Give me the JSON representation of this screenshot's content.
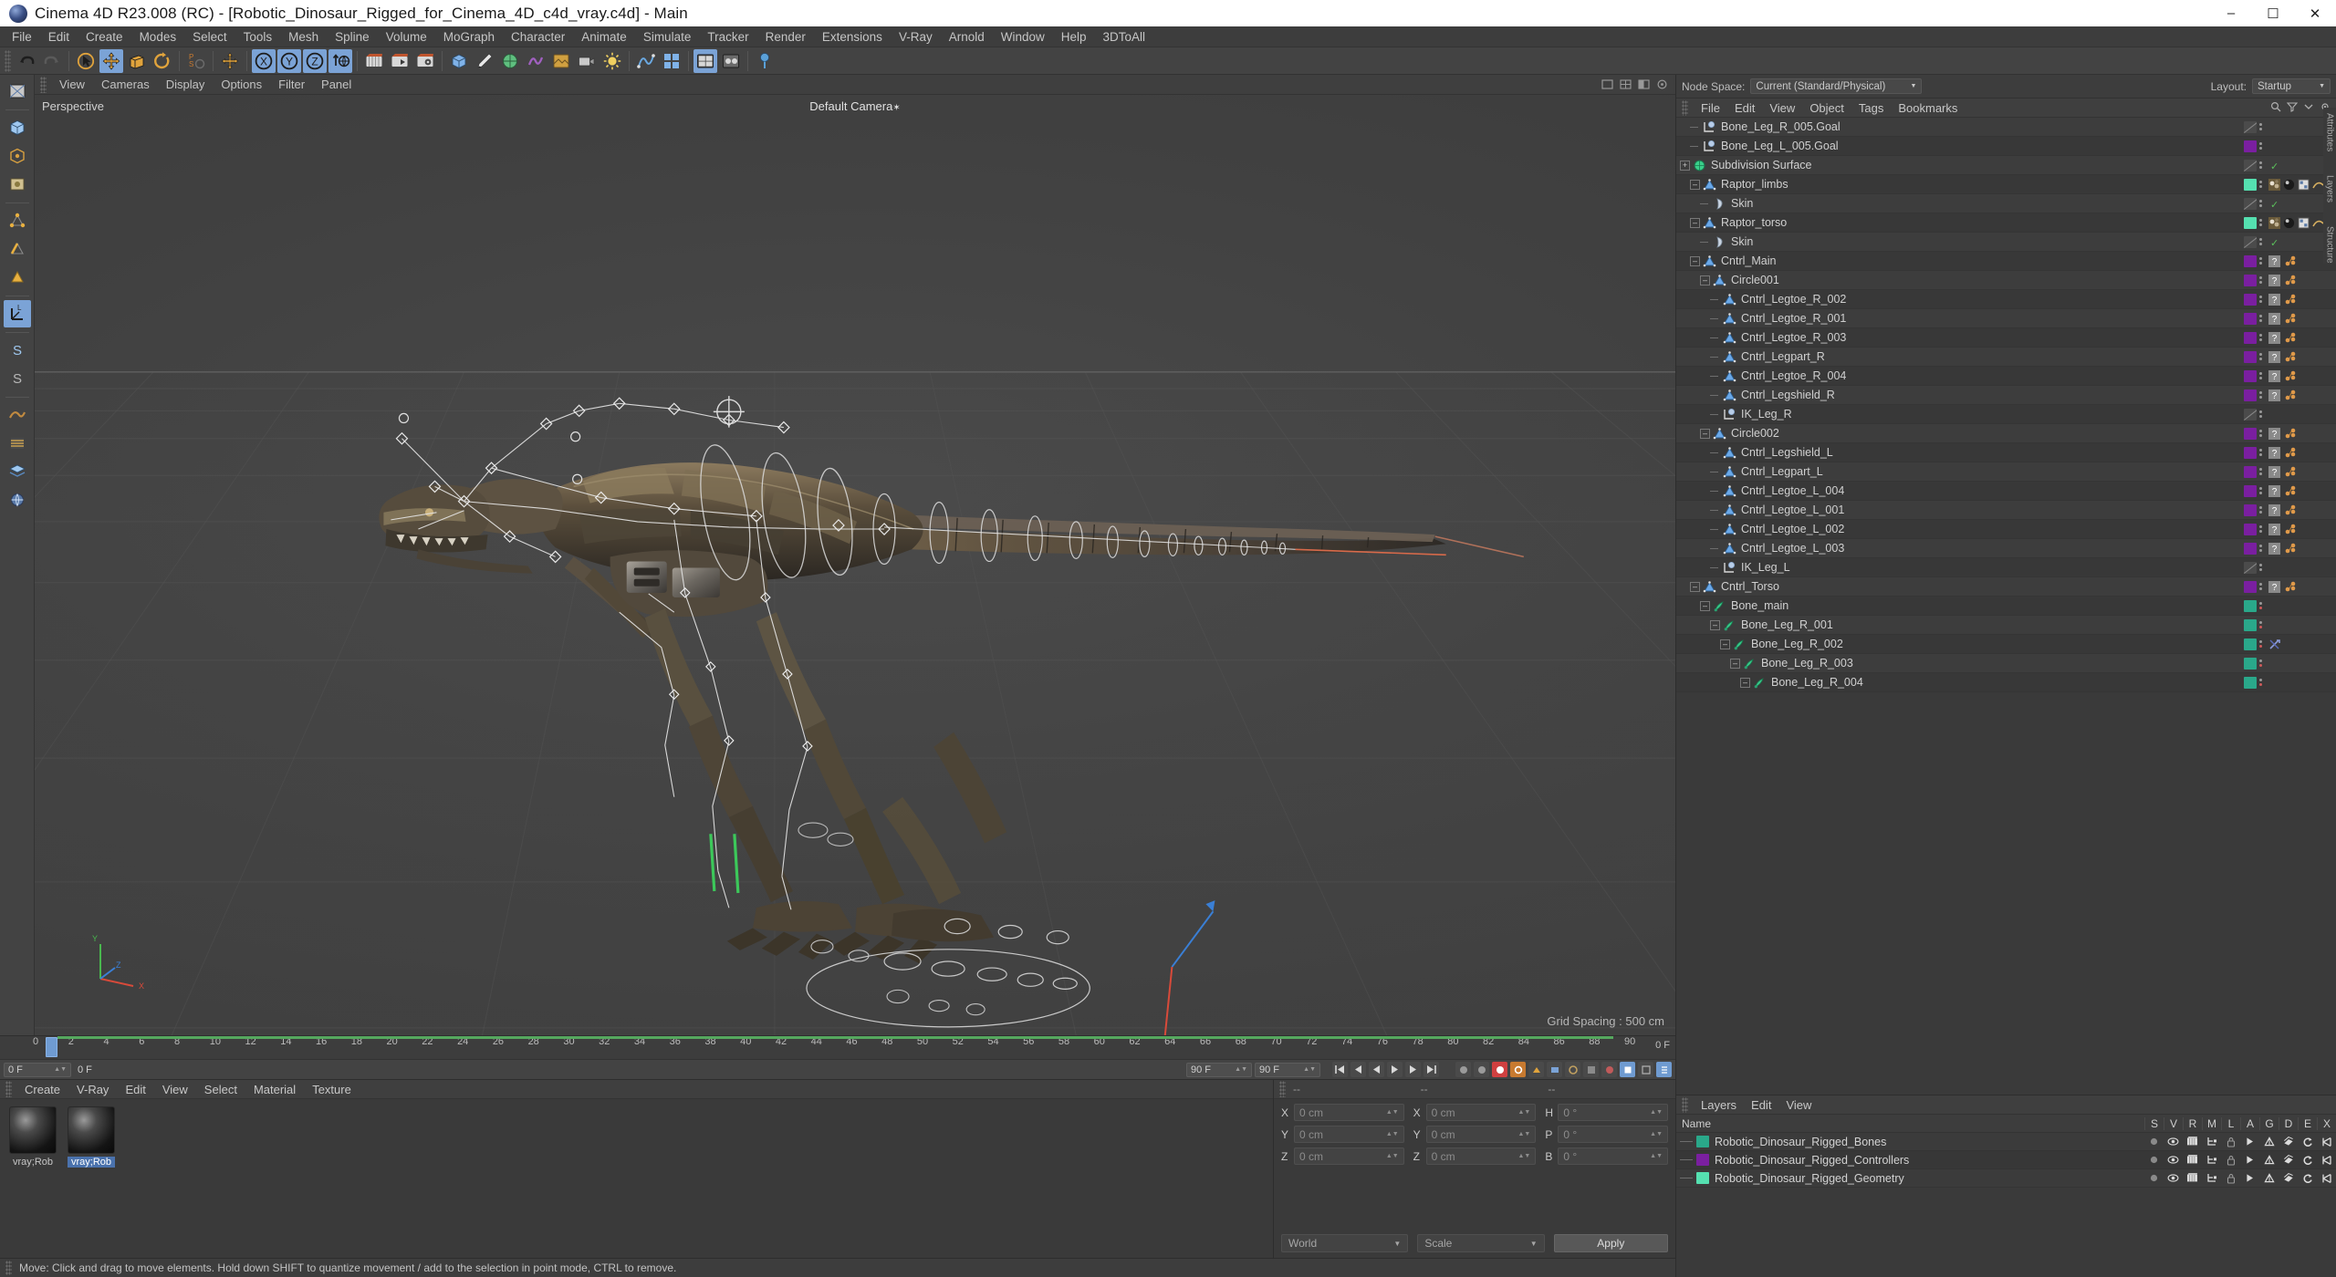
{
  "window": {
    "title": "Cinema 4D R23.008 (RC) - [Robotic_Dinosaur_Rigged_for_Cinema_4D_c4d_vray.c4d] - Main",
    "minimize": "–",
    "maximize": "☐",
    "close": "✕"
  },
  "menubar": {
    "items": [
      "File",
      "Edit",
      "Create",
      "Modes",
      "Select",
      "Tools",
      "Mesh",
      "Spline",
      "Volume",
      "MoGraph",
      "Character",
      "Animate",
      "Simulate",
      "Tracker",
      "Render",
      "Extensions",
      "V-Ray",
      "Arnold",
      "Window",
      "Help",
      "3DToAll"
    ]
  },
  "viewport": {
    "menu": [
      "View",
      "Cameras",
      "Display",
      "Options",
      "Filter",
      "Panel"
    ],
    "perspective_label": "Perspective",
    "camera_label": "Default Camera",
    "grid_spacing": "Grid Spacing : 500 cm",
    "axis_x": "X",
    "axis_y": "Y",
    "axis_z": "Z"
  },
  "timeline": {
    "ticks": [
      "0",
      "2",
      "4",
      "6",
      "8",
      "10",
      "12",
      "14",
      "16",
      "18",
      "20",
      "22",
      "24",
      "26",
      "28",
      "30",
      "32",
      "34",
      "36",
      "38",
      "40",
      "42",
      "44",
      "46",
      "48",
      "50",
      "52",
      "54",
      "56",
      "58",
      "60",
      "62",
      "64",
      "66",
      "68",
      "70",
      "72",
      "74",
      "76",
      "78",
      "80",
      "82",
      "84",
      "86",
      "88",
      "90"
    ],
    "end_label": "0 F",
    "current_frame": "0 F",
    "frame_field": "0 F",
    "start_field": "0 F",
    "range_start": "90 F",
    "range_end": "90 F"
  },
  "material_manager": {
    "menu": [
      "Create",
      "V-Ray",
      "Edit",
      "View",
      "Select",
      "Material",
      "Texture"
    ],
    "materials": [
      {
        "name": "vray;Rob",
        "selected": false
      },
      {
        "name": "vray;Rob",
        "selected": true
      }
    ]
  },
  "coordinate_manager": {
    "headers": [
      "--",
      "--",
      "--"
    ],
    "rows": [
      {
        "left_label": "X",
        "left_value": "0 cm",
        "mid_label": "X",
        "mid_value": "0 cm",
        "right_label": "H",
        "right_value": "0 °"
      },
      {
        "left_label": "Y",
        "left_value": "0 cm",
        "mid_label": "Y",
        "mid_value": "0 cm",
        "right_label": "P",
        "right_value": "0 °"
      },
      {
        "left_label": "Z",
        "left_value": "0 cm",
        "mid_label": "Z",
        "mid_value": "0 cm",
        "right_label": "B",
        "right_value": "0 °"
      }
    ],
    "system_select": "World",
    "mode_select": "Scale",
    "apply_button": "Apply"
  },
  "statusbar": {
    "text": "Move: Click and drag to move elements. Hold down SHIFT to quantize movement / add to the selection in point mode, CTRL to remove."
  },
  "object_manager": {
    "node_space_label": "Node Space:",
    "node_space_value": "Current (Standard/Physical)",
    "layout_label": "Layout:",
    "layout_value": "Startup",
    "menu": [
      "File",
      "Edit",
      "View",
      "Object",
      "Tags",
      "Bookmarks"
    ],
    "objects": [
      {
        "name": "Bone_Leg_R_005.Goal",
        "indent": 1,
        "icon": "null-goal-icon",
        "expander": "none",
        "chip": "none",
        "tags": []
      },
      {
        "name": "Bone_Leg_L_005.Goal",
        "indent": 1,
        "icon": "null-goal-icon",
        "expander": "none",
        "chip": "#7a1fa0",
        "tags": []
      },
      {
        "name": "Subdivision Surface",
        "indent": 0,
        "icon": "subdiv-icon",
        "expander": "plus",
        "chip": "none",
        "tags": [
          "check"
        ]
      },
      {
        "name": "Raptor_limbs",
        "indent": 1,
        "icon": "polygon-icon",
        "expander": "minus",
        "chip": "#55e0b0",
        "tags": [
          "texture",
          "material",
          "uv",
          "phong"
        ]
      },
      {
        "name": "Skin",
        "indent": 2,
        "icon": "skin-icon",
        "expander": "none",
        "chip": "none",
        "tags": [
          "check"
        ]
      },
      {
        "name": "Raptor_torso",
        "indent": 1,
        "icon": "polygon-icon",
        "expander": "minus",
        "chip": "#55e0b0",
        "tags": [
          "texture",
          "material",
          "uv",
          "phong"
        ]
      },
      {
        "name": "Skin",
        "indent": 2,
        "icon": "skin-icon",
        "expander": "none",
        "chip": "none",
        "tags": [
          "check"
        ]
      },
      {
        "name": "Cntrl_Main",
        "indent": 1,
        "icon": "polygon-icon",
        "expander": "minus",
        "chip": "#7a1fa0",
        "tags": [
          "unknown",
          "xpresso"
        ]
      },
      {
        "name": "Circle001",
        "indent": 2,
        "icon": "polygon-icon",
        "expander": "minus",
        "chip": "#7a1fa0",
        "tags": [
          "unknown",
          "xpresso"
        ]
      },
      {
        "name": "Cntrl_Legtoe_R_002",
        "indent": 3,
        "icon": "polygon-icon",
        "expander": "none",
        "chip": "#7a1fa0",
        "tags": [
          "unknown",
          "xpresso"
        ]
      },
      {
        "name": "Cntrl_Legtoe_R_001",
        "indent": 3,
        "icon": "polygon-icon",
        "expander": "none",
        "chip": "#7a1fa0",
        "tags": [
          "unknown",
          "xpresso"
        ]
      },
      {
        "name": "Cntrl_Legtoe_R_003",
        "indent": 3,
        "icon": "polygon-icon",
        "expander": "none",
        "chip": "#7a1fa0",
        "tags": [
          "unknown",
          "xpresso"
        ]
      },
      {
        "name": "Cntrl_Legpart_R",
        "indent": 3,
        "icon": "polygon-icon",
        "expander": "none",
        "chip": "#7a1fa0",
        "tags": [
          "unknown",
          "xpresso"
        ]
      },
      {
        "name": "Cntrl_Legtoe_R_004",
        "indent": 3,
        "icon": "polygon-icon",
        "expander": "none",
        "chip": "#7a1fa0",
        "tags": [
          "unknown",
          "xpresso"
        ]
      },
      {
        "name": "Cntrl_Legshield_R",
        "indent": 3,
        "icon": "polygon-icon",
        "expander": "none",
        "chip": "#7a1fa0",
        "tags": [
          "unknown",
          "xpresso"
        ]
      },
      {
        "name": "IK_Leg_R",
        "indent": 3,
        "icon": "null-goal-icon",
        "expander": "none",
        "chip": "none",
        "tags": []
      },
      {
        "name": "Circle002",
        "indent": 2,
        "icon": "polygon-icon",
        "expander": "minus",
        "chip": "#7a1fa0",
        "tags": [
          "unknown",
          "xpresso"
        ]
      },
      {
        "name": "Cntrl_Legshield_L",
        "indent": 3,
        "icon": "polygon-icon",
        "expander": "none",
        "chip": "#7a1fa0",
        "tags": [
          "unknown",
          "xpresso"
        ]
      },
      {
        "name": "Cntrl_Legpart_L",
        "indent": 3,
        "icon": "polygon-icon",
        "expander": "none",
        "chip": "#7a1fa0",
        "tags": [
          "unknown",
          "xpresso"
        ]
      },
      {
        "name": "Cntrl_Legtoe_L_004",
        "indent": 3,
        "icon": "polygon-icon",
        "expander": "none",
        "chip": "#7a1fa0",
        "tags": [
          "unknown",
          "xpresso"
        ]
      },
      {
        "name": "Cntrl_Legtoe_L_001",
        "indent": 3,
        "icon": "polygon-icon",
        "expander": "none",
        "chip": "#7a1fa0",
        "tags": [
          "unknown",
          "xpresso"
        ]
      },
      {
        "name": "Cntrl_Legtoe_L_002",
        "indent": 3,
        "icon": "polygon-icon",
        "expander": "none",
        "chip": "#7a1fa0",
        "tags": [
          "unknown",
          "xpresso"
        ]
      },
      {
        "name": "Cntrl_Legtoe_L_003",
        "indent": 3,
        "icon": "polygon-icon",
        "expander": "none",
        "chip": "#7a1fa0",
        "tags": [
          "unknown",
          "xpresso"
        ]
      },
      {
        "name": "IK_Leg_L",
        "indent": 3,
        "icon": "null-goal-icon",
        "expander": "none",
        "chip": "none",
        "tags": []
      },
      {
        "name": "Cntrl_Torso",
        "indent": 1,
        "icon": "polygon-icon",
        "expander": "minus",
        "chip": "#7a1fa0",
        "tags": [
          "unknown",
          "xpresso"
        ]
      },
      {
        "name": "Bone_main",
        "indent": 2,
        "icon": "joint-icon",
        "expander": "minus",
        "chip": "#2aa88a",
        "tags": []
      },
      {
        "name": "Bone_Leg_R_001",
        "indent": 3,
        "icon": "joint-icon",
        "expander": "minus",
        "chip": "#2aa88a",
        "tags": []
      },
      {
        "name": "Bone_Leg_R_002",
        "indent": 4,
        "icon": "joint-icon",
        "expander": "minus",
        "chip": "#2aa88a",
        "tags": [
          "ik"
        ]
      },
      {
        "name": "Bone_Leg_R_003",
        "indent": 5,
        "icon": "joint-icon",
        "expander": "minus",
        "chip": "#2aa88a",
        "tags": []
      },
      {
        "name": "Bone_Leg_R_004",
        "indent": 6,
        "icon": "joint-icon",
        "expander": "minus",
        "chip": "#2aa88a",
        "tags": []
      }
    ]
  },
  "layer_manager": {
    "menu": [
      "Layers",
      "Edit",
      "View"
    ],
    "name_header": "Name",
    "columns": [
      "S",
      "V",
      "R",
      "M",
      "L",
      "A",
      "G",
      "D",
      "E",
      "X"
    ],
    "layers": [
      {
        "name": "Robotic_Dinosaur_Rigged_Bones",
        "color": "#2aa88a"
      },
      {
        "name": "Robotic_Dinosaur_Rigged_Controllers",
        "color": "#7a1fa0"
      },
      {
        "name": "Robotic_Dinosaur_Rigged_Geometry",
        "color": "#55e0b0"
      }
    ]
  },
  "right_edge_tabs": [
    "Attributes",
    "Layers",
    "Structure"
  ],
  "colors": {
    "accent_blue": "#7ba3d6",
    "panel_bg": "#3a3a3a",
    "toolbar_bg": "#434343",
    "bone_teal": "#2aa88a",
    "controller_purple": "#7a1fa0",
    "geometry_mint": "#55e0b0",
    "record_red": "#d04040",
    "text": "#c8c8c8"
  }
}
